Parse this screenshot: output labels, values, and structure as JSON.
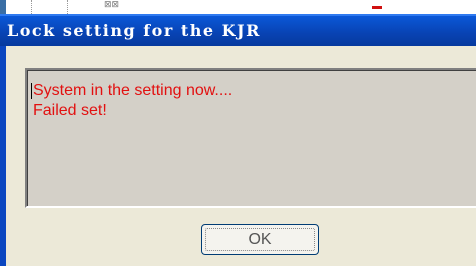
{
  "dialog": {
    "title": "Lock setting for the KJR",
    "messages": [
      "System in the setting now....",
      "Failed set!"
    ],
    "ok_label": "OK"
  },
  "background": {
    "icon_glyph": "⊠⊠"
  },
  "colors": {
    "titlebar": "#0a4fcc",
    "message_text": "#e21010",
    "dialog_face": "#ece9d8"
  }
}
